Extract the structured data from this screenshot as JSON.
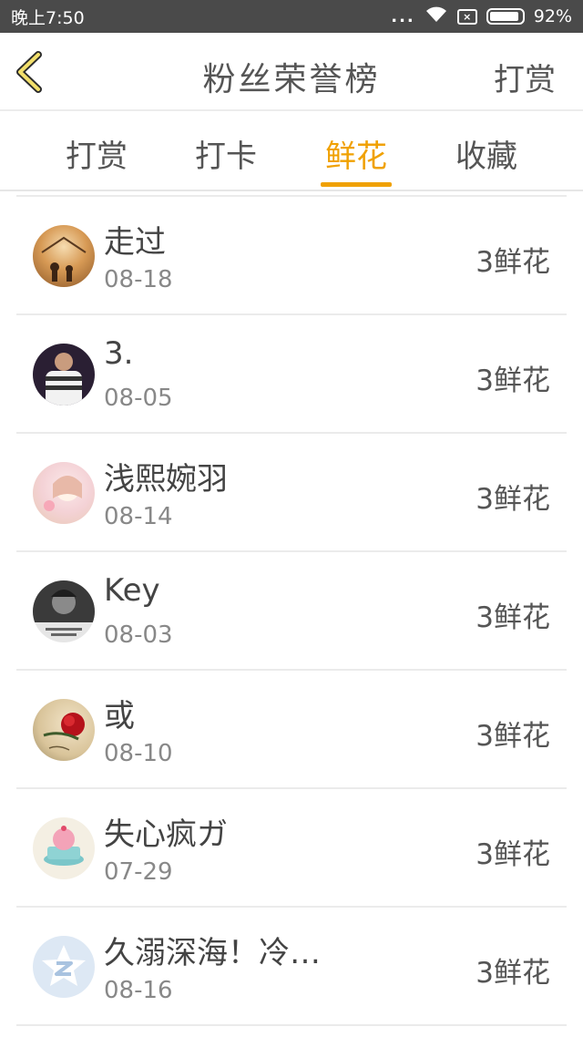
{
  "status_bar": {
    "time": "晚上7:50",
    "signal_dots": "...",
    "sim_icon_text": "×",
    "battery": "92%",
    "battery_level": 0.92
  },
  "header": {
    "title": "粉丝荣誉榜",
    "action_label": "打赏",
    "icon": "chevron-left-icon"
  },
  "tabs": [
    {
      "label": "打赏",
      "active": false
    },
    {
      "label": "打卡",
      "active": false
    },
    {
      "label": "鲜花",
      "active": true
    },
    {
      "label": "收藏",
      "active": false
    }
  ],
  "colors": {
    "accent": "#f0a100",
    "status_bar": "#4a4a4a"
  },
  "fans": [
    {
      "name": "走过",
      "date": "08-18",
      "count": "3鲜花"
    },
    {
      "name": "3.",
      "date": "08-05",
      "count": "3鲜花"
    },
    {
      "name": "浅熙婉羽",
      "date": "08-14",
      "count": "3鲜花"
    },
    {
      "name": "Key",
      "date": "08-03",
      "count": "3鲜花"
    },
    {
      "name": "或",
      "date": "08-10",
      "count": "3鲜花"
    },
    {
      "name": "失心疯ガ",
      "date": "07-29",
      "count": "3鲜花"
    },
    {
      "name": "久溺深海！冷…",
      "date": "08-16",
      "count": "3鲜花"
    }
  ]
}
